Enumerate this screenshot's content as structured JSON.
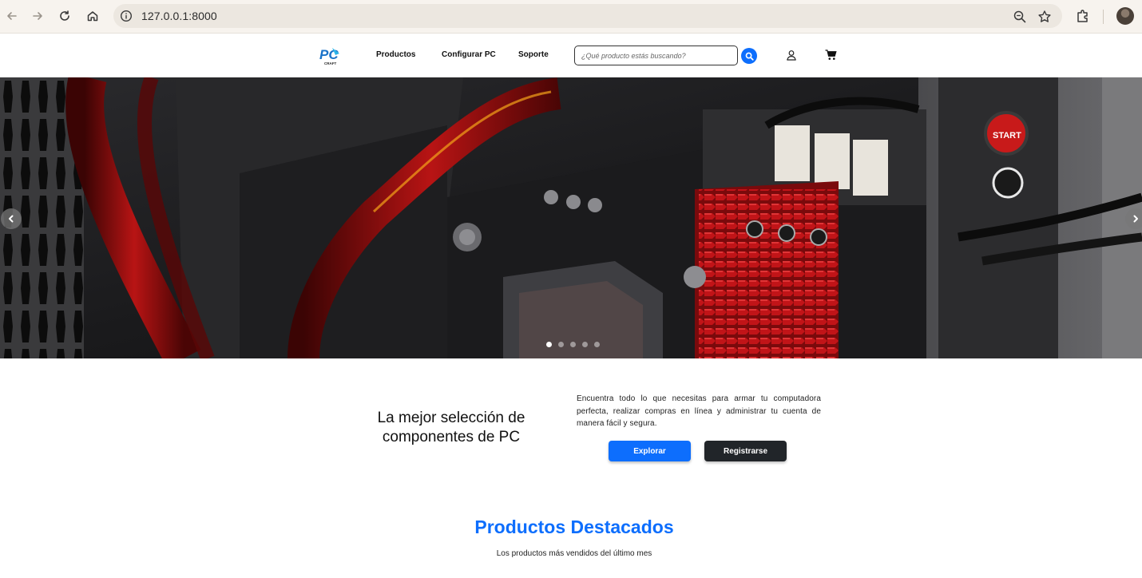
{
  "browser": {
    "url": "127.0.0.1:8000",
    "icons": [
      "back-arrow-icon",
      "forward-arrow-icon",
      "reload-icon",
      "home-icon",
      "site-info-icon",
      "zoom-icon",
      "bookmark-star-icon",
      "extensions-icon",
      "profile-avatar"
    ]
  },
  "header": {
    "logo_text": "PC",
    "logo_subtext": "CRAFT",
    "nav": [
      {
        "label": "Productos"
      },
      {
        "label": "Configurar PC"
      },
      {
        "label": "Soporte"
      }
    ],
    "search": {
      "placeholder": "¿Qué producto estás buscando?"
    }
  },
  "hero": {
    "slide_count": 5,
    "active_slide": 1
  },
  "intro": {
    "title": "La mejor selección de componentes de PC",
    "text": "Encuentra todo lo que necesitas para armar tu computadora perfecta, realizar compras en línea y administrar tu cuenta de manera fácil y segura.",
    "explore_label": "Explorar",
    "register_label": "Registrarse"
  },
  "featured": {
    "title": "Productos Destacados",
    "subtitle": "Los productos más vendidos del último mes"
  },
  "colors": {
    "accent": "#0d6efd",
    "dark": "#212529"
  }
}
